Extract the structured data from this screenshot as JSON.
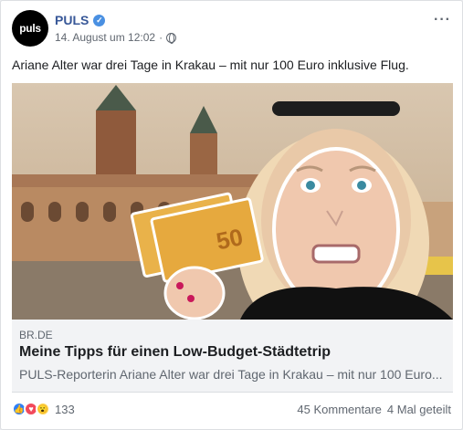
{
  "author": {
    "name": "PULS",
    "avatar_text": "puls",
    "date": "14. August um 12:02"
  },
  "post": {
    "text": "Ariane Alter war drei Tage in Krakau – mit nur 100 Euro inklusive Flug."
  },
  "link": {
    "domain": "BR.DE",
    "title": "Meine Tipps für einen Low-Budget-Städtetrip",
    "description": "PULS-Reporterin Ariane Alter war drei Tage in Krakau – mit nur 100 Euro..."
  },
  "image": {
    "banknote_value": "50"
  },
  "footer": {
    "reaction_count": "133",
    "comments": "45 Kommentare",
    "shares": "4 Mal geteilt"
  },
  "icons": [
    "verified-icon",
    "globe-icon",
    "more-icon",
    "like-icon",
    "love-icon",
    "wow-icon"
  ]
}
